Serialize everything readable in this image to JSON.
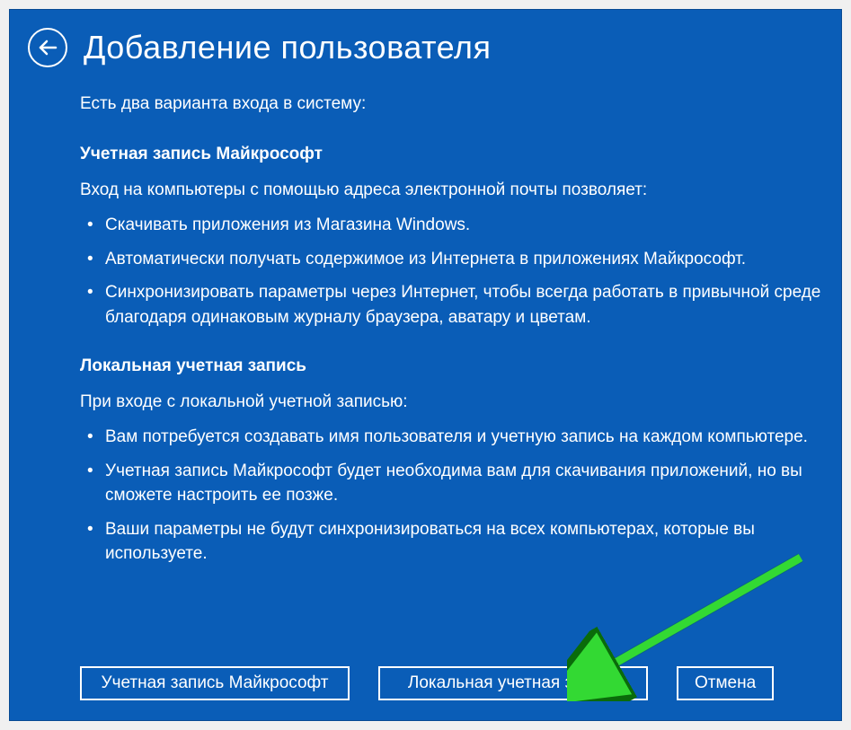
{
  "header": {
    "title": "Добавление пользователя"
  },
  "intro": "Есть два варианта входа в систему:",
  "sections": {
    "microsoft": {
      "heading": "Учетная запись Майкрософт",
      "lead": "Вход на компьютеры с помощью адреса электронной почты позволяет:",
      "items": [
        "Скачивать приложения из Магазина Windows.",
        "Автоматически получать содержимое из Интернета в приложениях Майкрософт.",
        "Синхронизировать параметры через Интернет, чтобы всегда работать в привычной среде благодаря одинаковым журналу браузера, аватару и цветам."
      ]
    },
    "local": {
      "heading": "Локальная учетная запись",
      "lead": "При входе с локальной учетной записью:",
      "items": [
        "Вам потребуется создавать имя пользователя и учетную запись на каждом компьютере.",
        "Учетная запись Майкрософт будет необходима вам для скачивания приложений, но вы сможете настроить ее позже.",
        "Ваши параметры не будут синхронизироваться на всех компьютерах, которые вы используете."
      ]
    }
  },
  "buttons": {
    "microsoft": "Учетная запись Майкрософт",
    "local": "Локальная учетная запись",
    "cancel": "Отмена"
  }
}
